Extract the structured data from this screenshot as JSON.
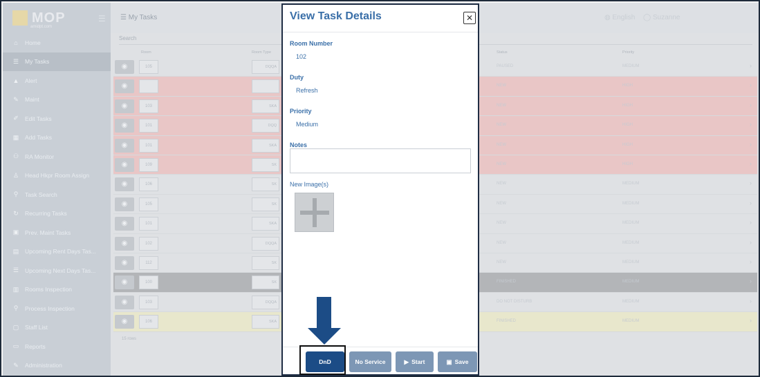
{
  "app": {
    "logo_text": "MOP",
    "logo_sub": "amidpt.com"
  },
  "sidebar": {
    "items": [
      {
        "label": "Home",
        "icon": "⌂"
      },
      {
        "label": "My Tasks",
        "icon": "☰",
        "active": true
      },
      {
        "label": "Alert",
        "icon": "▲"
      },
      {
        "label": "Maint",
        "icon": "✎"
      },
      {
        "label": "Edit Tasks",
        "icon": "✐"
      },
      {
        "label": "Add Tasks",
        "icon": "▦"
      },
      {
        "label": "RA Monitor",
        "icon": "⚇"
      },
      {
        "label": "Head Hkpr Room Assign",
        "icon": "♙"
      },
      {
        "label": "Task Search",
        "icon": "⚲"
      },
      {
        "label": "Recurring Tasks",
        "icon": "↻"
      },
      {
        "label": "Prev. Maint Tasks",
        "icon": "▣"
      },
      {
        "label": "Upcoming Rent Days Tas...",
        "icon": "▤"
      },
      {
        "label": "Upcoming Next Days Tas...",
        "icon": "☰"
      },
      {
        "label": "Rooms Inspection",
        "icon": "▥"
      },
      {
        "label": "Process Inspection",
        "icon": "⚲"
      },
      {
        "label": "Staff List",
        "icon": "▢"
      },
      {
        "label": "Reports",
        "icon": "▭"
      },
      {
        "label": "Administration",
        "icon": "✎"
      }
    ]
  },
  "header": {
    "title": "My Tasks",
    "language": "English",
    "user": "Suzanne"
  },
  "search": {
    "placeholder": "Search"
  },
  "table": {
    "columns": [
      "Room",
      "Room Type",
      "Status",
      "Priority"
    ],
    "rows": [
      {
        "room": "105",
        "type": "DQQA",
        "status": "PAUSED",
        "priority": "MEDIUM",
        "tone": "plain"
      },
      {
        "room": "",
        "type": "",
        "status": "NEW",
        "priority": "HIGH",
        "tone": "red"
      },
      {
        "room": "103",
        "type": "SKA",
        "status": "NEW",
        "priority": "HIGH",
        "tone": "red"
      },
      {
        "room": "101",
        "type": "DQQ",
        "status": "NEW",
        "priority": "HIGH",
        "tone": "red"
      },
      {
        "room": "101",
        "type": "SKA",
        "status": "NEW",
        "priority": "HIGH",
        "tone": "red"
      },
      {
        "room": "109",
        "type": "SK",
        "status": "NEW",
        "priority": "HIGH",
        "tone": "red"
      },
      {
        "room": "106",
        "type": "SK",
        "status": "NEW",
        "priority": "MEDIUM",
        "tone": "plain"
      },
      {
        "room": "105",
        "type": "SK",
        "status": "NEW",
        "priority": "MEDIUM",
        "tone": "plain"
      },
      {
        "room": "101",
        "type": "SKA",
        "status": "NEW",
        "priority": "MEDIUM",
        "tone": "plain"
      },
      {
        "room": "102",
        "type": "DQQA",
        "status": "NEW",
        "priority": "MEDIUM",
        "tone": "plain"
      },
      {
        "room": "112",
        "type": "SK",
        "status": "NEW",
        "priority": "MEDIUM",
        "tone": "plain"
      },
      {
        "room": "100",
        "type": "SK",
        "status": "FINISHED",
        "priority": "MEDIUM",
        "tone": "gray"
      },
      {
        "room": "103",
        "type": "DQQA",
        "status": "DO NOT DISTURB",
        "priority": "MEDIUM",
        "tone": "plain"
      },
      {
        "room": "106",
        "type": "SKA",
        "status": "FINISHED",
        "priority": "MEDIUM",
        "tone": "yellow"
      }
    ],
    "footnote": "15 rows"
  },
  "modal": {
    "title": "View Task Details",
    "close_symbol": "✕",
    "room_number_label": "Room Number",
    "room_number": "102",
    "duty_label": "Duty",
    "duty": "Refresh",
    "priority_label": "Priority",
    "priority": "Medium",
    "notes_label": "Notes",
    "notes_value": "",
    "new_images_label": "New Image(s)",
    "buttons": {
      "dnd": "DnD",
      "no_service": "No Service",
      "start": "Start",
      "save": "Save"
    }
  },
  "colors": {
    "accent": "#3a6fa8",
    "primary_button": "#1c4c86",
    "muted_button": "#7d97b5"
  }
}
